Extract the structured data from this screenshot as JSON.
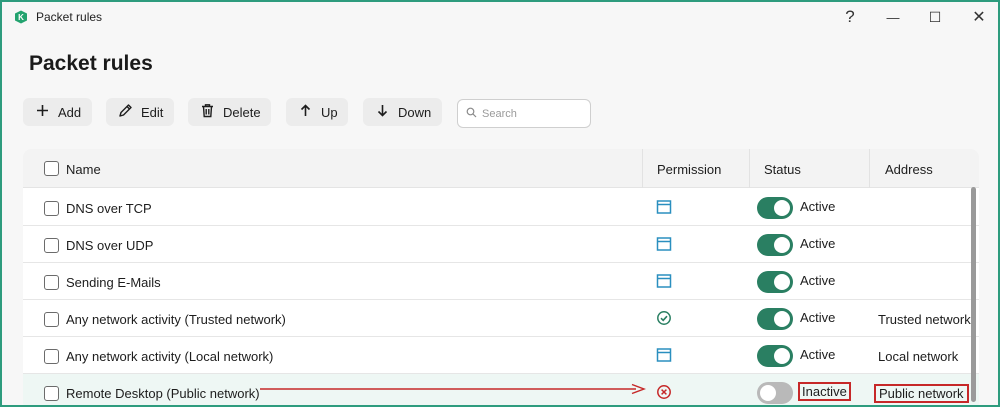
{
  "window": {
    "title": "Packet rules",
    "help": "?",
    "minimize": "—",
    "maximize": "☐",
    "close": "✕",
    "border_color": "#2e9c7e"
  },
  "page": {
    "title": "Packet rules"
  },
  "toolbar": {
    "add": "Add",
    "edit": "Edit",
    "delete": "Delete",
    "up": "Up",
    "down": "Down",
    "search_placeholder": "Search"
  },
  "table": {
    "headers": {
      "name": "Name",
      "permission": "Permission",
      "status": "Status",
      "address": "Address"
    },
    "rows": [
      {
        "name": "DNS over TCP",
        "permission_icon": "window-icon",
        "status": "Active",
        "enabled": true,
        "address": ""
      },
      {
        "name": "DNS over UDP",
        "permission_icon": "window-icon",
        "status": "Active",
        "enabled": true,
        "address": ""
      },
      {
        "name": "Sending E-Mails",
        "permission_icon": "window-icon",
        "status": "Active",
        "enabled": true,
        "address": ""
      },
      {
        "name": "Any network activity (Trusted network)",
        "permission_icon": "check-circle-icon",
        "status": "Active",
        "enabled": true,
        "address": "Trusted network"
      },
      {
        "name": "Any network activity (Local network)",
        "permission_icon": "window-icon",
        "status": "Active",
        "enabled": true,
        "address": "Local network"
      },
      {
        "name": "Remote Desktop (Public network)",
        "permission_icon": "block-circle-icon",
        "status": "Inactive",
        "enabled": false,
        "address": "Public network"
      }
    ]
  },
  "colors": {
    "accent": "#2a7f62",
    "permission_icon": "#2a8fbf",
    "block_icon": "#c62828",
    "highlight": "#c62828"
  }
}
